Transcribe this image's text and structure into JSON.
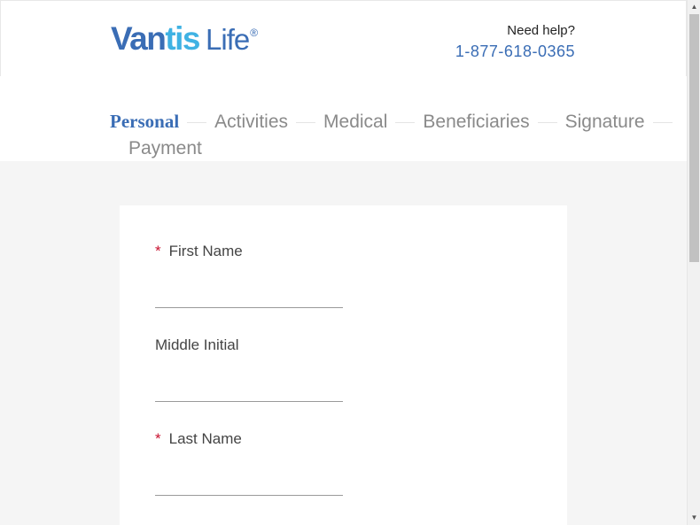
{
  "header": {
    "logo": {
      "brand_bold": "Vantis",
      "brand_light": "Life",
      "registered": "®"
    },
    "help_label": "Need help?",
    "help_phone": "1-877-618-0365"
  },
  "steps": [
    {
      "label": "Personal",
      "active": true
    },
    {
      "label": "Activities",
      "active": false
    },
    {
      "label": "Medical",
      "active": false
    },
    {
      "label": "Beneficiaries",
      "active": false
    },
    {
      "label": "Signature",
      "active": false
    },
    {
      "label": "Payment",
      "active": false
    }
  ],
  "form": {
    "required_marker": "*",
    "first_name": {
      "label": "First Name",
      "value": "",
      "required": true
    },
    "middle_initial": {
      "label": "Middle Initial",
      "value": "",
      "required": false
    },
    "last_name": {
      "label": "Last Name",
      "value": "",
      "required": true
    }
  },
  "colors": {
    "brand_blue": "#3a6db5",
    "brand_cyan": "#3fb2e3",
    "required_red": "#c8102e",
    "inactive_step": "#8a8a8a"
  },
  "scrollbar": {
    "up_icon": "triangle-up-icon",
    "down_icon": "triangle-down-icon"
  }
}
